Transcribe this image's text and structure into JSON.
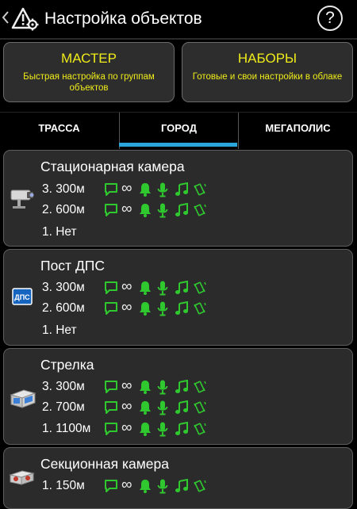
{
  "header": {
    "title": "Настройка объектов",
    "back_icon": "chevron-left-icon",
    "app_icon": "warning-gear-icon",
    "help_label": "?"
  },
  "buttons": {
    "master": {
      "title": "МАСТЕР",
      "subtitle": "Быстрая настройка по группам объектов"
    },
    "sets": {
      "title": "НАБОРЫ",
      "subtitle": "Готовые и свои настройки в облаке"
    }
  },
  "tabs": [
    {
      "label": "ТРАССА",
      "active": false
    },
    {
      "label": "ГОРОД",
      "active": true
    },
    {
      "label": "МЕГАПОЛИС",
      "active": false
    }
  ],
  "colors": {
    "accent": "#f0ec1a",
    "tab_indicator": "#2aa6dc",
    "alert_green": "#2fc92f",
    "card_bg": "#2b2b2b"
  },
  "objects": [
    {
      "title": "Стационарная камера",
      "icon": "fixed-camera-icon",
      "rows": [
        {
          "label": "3. 300м",
          "alerts": true
        },
        {
          "label": "2. 600м",
          "alerts": true
        },
        {
          "label": "1. Нет",
          "alerts": false
        }
      ]
    },
    {
      "title": "Пост ДПС",
      "icon": "police-post-icon",
      "icon_text": "ДПС",
      "rows": [
        {
          "label": "3. 300м",
          "alerts": true
        },
        {
          "label": "2. 600м",
          "alerts": true
        },
        {
          "label": "1. Нет",
          "alerts": false
        }
      ]
    },
    {
      "title": "Стрелка",
      "icon": "strelka-radar-icon",
      "rows": [
        {
          "label": "3. 300м",
          "alerts": true
        },
        {
          "label": "2. 700м",
          "alerts": true
        },
        {
          "label": "1. 1100м",
          "alerts": true
        }
      ]
    },
    {
      "title": "Секционная камера",
      "icon": "section-camera-icon",
      "rows": [
        {
          "label": "1. 150м",
          "alerts": true
        }
      ]
    }
  ],
  "alert_icons": [
    "message-icon",
    "infinity-icon",
    "bell-icon",
    "microphone-icon",
    "music-note-icon",
    "vibrate-icon"
  ]
}
